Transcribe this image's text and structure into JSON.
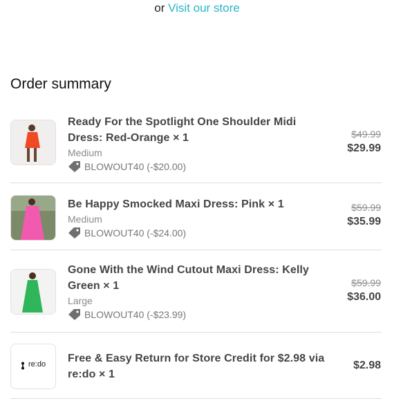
{
  "header": {
    "or_text": "or",
    "store_link": "Visit our store"
  },
  "summary": {
    "title": "Order summary"
  },
  "items": [
    {
      "name": "Ready For the Spotlight One Shoulder Midi Dress: Red-Orange × 1",
      "variant": "Medium",
      "discount": "BLOWOUT40 (-$20.00)",
      "original_price": "$49.99",
      "price": "$29.99",
      "image": "red-orange-dress-thumbnail"
    },
    {
      "name": "Be Happy Smocked Maxi Dress: Pink × 1",
      "variant": "Medium",
      "discount": "BLOWOUT40 (-$24.00)",
      "original_price": "$59.99",
      "price": "$35.99",
      "image": "pink-dress-thumbnail"
    },
    {
      "name": "Gone With the Wind Cutout Maxi Dress: Kelly Green × 1",
      "variant": "Large",
      "discount": "BLOWOUT40 (-$23.99)",
      "original_price": "$59.99",
      "price": "$36.00",
      "image": "green-dress-thumbnail"
    },
    {
      "name": "Free & Easy Return for Store Credit for $2.98 via re:do × 1",
      "price": "$2.98",
      "logo_text": "re:do",
      "image": "redo-logo"
    }
  ],
  "colors": {
    "accent": "#2ab5c5",
    "text": "#444444",
    "muted": "#8a8a8a"
  }
}
